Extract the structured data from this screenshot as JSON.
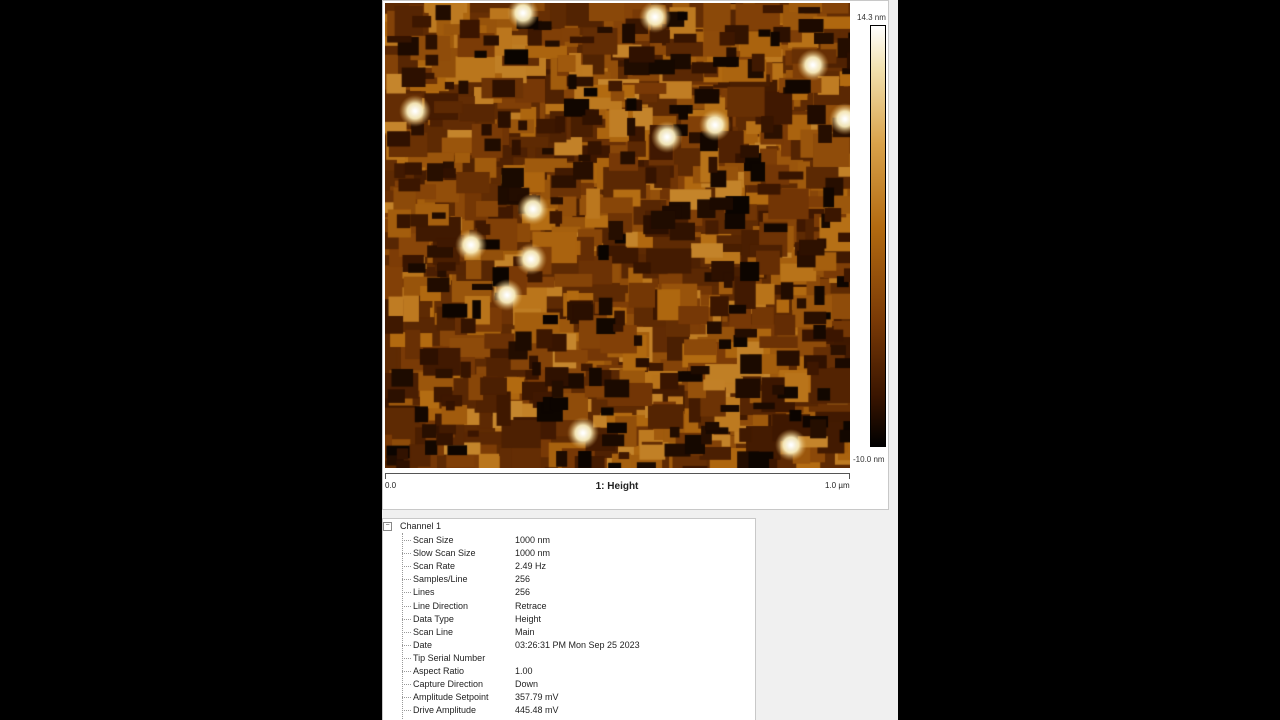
{
  "image": {
    "title": "1: Height",
    "colorbar_max": "14.3 nm",
    "colorbar_min": "-10.0 nm",
    "axis_start": "0.0",
    "axis_end": "1.0 µm"
  },
  "properties": {
    "group_label": "Channel 1",
    "toggle_symbol": "−",
    "rows": [
      {
        "name": "Scan Size",
        "value": "1000 nm"
      },
      {
        "name": "Slow Scan Size",
        "value": "1000 nm"
      },
      {
        "name": "Scan Rate",
        "value": "2.49 Hz"
      },
      {
        "name": "Samples/Line",
        "value": "256"
      },
      {
        "name": "Lines",
        "value": "256"
      },
      {
        "name": "Line Direction",
        "value": "Retrace"
      },
      {
        "name": "Data Type",
        "value": "Height"
      },
      {
        "name": "Scan Line",
        "value": "Main"
      },
      {
        "name": "Date",
        "value": "03:26:31 PM Mon Sep 25 2023"
      },
      {
        "name": "Tip Serial Number",
        "value": ""
      },
      {
        "name": "Aspect Ratio",
        "value": "1.00"
      },
      {
        "name": "Capture Direction",
        "value": "Down"
      },
      {
        "name": "Amplitude Setpoint",
        "value": "357.79 mV"
      },
      {
        "name": "Drive Amplitude",
        "value": "445.48 mV"
      }
    ]
  }
}
